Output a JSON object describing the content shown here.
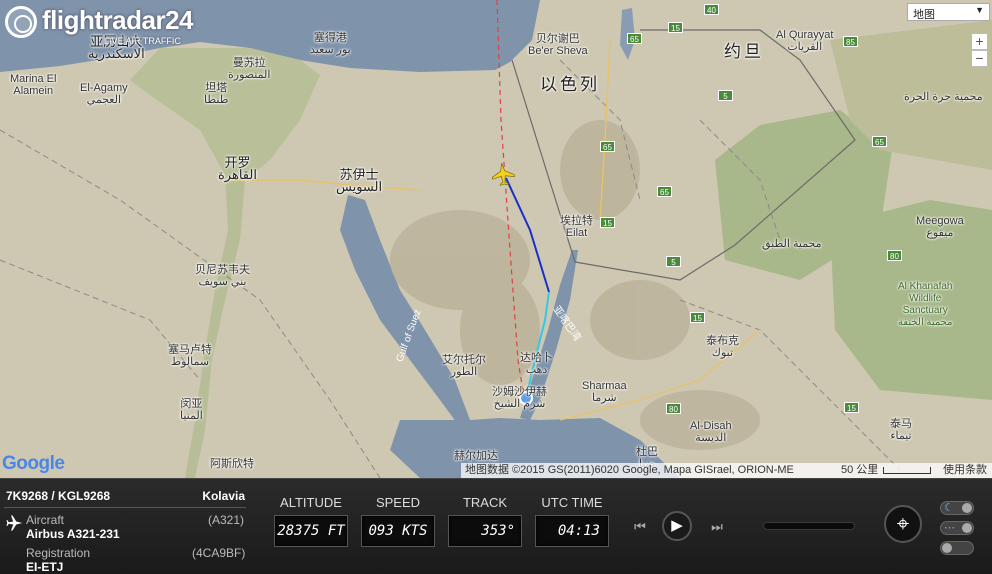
{
  "app": {
    "logo_text": "flightradar24",
    "tagline": "LIVE AIR TRAFFIC"
  },
  "map": {
    "map_type_label": "地图",
    "zoom_in": "+",
    "zoom_out": "−",
    "google_logo": "Google",
    "attribution": "地图数据 ©2015 GS(2011)6020 Google, Mapa GISrael, ORION-ME",
    "scale_label": "50 公里",
    "terms_label": "使用条款",
    "labels": {
      "alexandria": "亚历山大\nالاسكندرية",
      "marina": "Marina El\nAlamein",
      "elagamy": "El-Agamy\nالعجمي",
      "mansoura": "曼苏拉\nالمنصورة",
      "tanta": "坦塔\nطنطا",
      "portsaid": "塞得港\nبور سعيد",
      "cairo": "开罗\nالقاهرة",
      "suez": "苏伊士\nالسويس",
      "benisuef": "贝尼苏韦夫\nبني سويف",
      "samalut": "塞马卢特\nسمالوط",
      "minya": "闵亚\nالمنيا",
      "assiut": "阿斯欣特",
      "beersheva": "贝尔谢巴\nBe'er Sheva",
      "israel": "以色列",
      "jordan": "约旦",
      "qurayyat": "Al Qurayyat\nالقريات",
      "harrah": "محمية حرة الحرة",
      "tubaiq": "محمية الطبق",
      "meegowa": "Meegowa\nميقوع",
      "eilat": "埃拉特\nEilat",
      "alkhanafah": "Al Khanafah\nWildlife\nSanctuary\nمحمية الخنفة",
      "tabuk": "泰布克\nتبوك",
      "aldisah": "Al-Disah\nالديسة",
      "taima": "泰马\nتيماء",
      "sharmaa": "Sharmaa\nشرما",
      "duba": "杜巴\nضبا",
      "altor": "艾尔托尔\nالطور",
      "dahab": "达哈卜\nدهب",
      "sharm": "沙姆沙伊赫\nشرم الشيخ",
      "hurghada": "赫尔加达",
      "gulf_suez": "Gulf of Suez",
      "gulf_aqaba": "亚喀巴湾"
    },
    "road_signs": [
      "40",
      "65",
      "15",
      "65",
      "15",
      "65",
      "5",
      "5",
      "15",
      "80",
      "80",
      "15",
      "85",
      "65"
    ]
  },
  "flight": {
    "callsign": "7K9268 / KGL9268",
    "airline": "Kolavia",
    "aircraft_label": "Aircraft",
    "aircraft_code": "(A321)",
    "aircraft_type": "Airbus A321-231",
    "registration_label": "Registration",
    "registration_code": "(4CA9BF)",
    "registration": "EI-ETJ"
  },
  "gauges": {
    "altitude_label": "ALTITUDE",
    "altitude_value": "28375 FT",
    "speed_label": "SPEED",
    "speed_value": "093 KTS",
    "track_label": "TRACK",
    "track_value": "353°",
    "time_label": "UTC TIME",
    "time_value": "04:13"
  },
  "playback": {
    "rewind": "⏮",
    "play": "▶",
    "forward": "⏭"
  },
  "colors": {
    "track_blue": "#1a2fc9",
    "track_cyan": "#36c6e6",
    "route_red": "#e04040",
    "plane_yellow": "#f5d21a"
  }
}
